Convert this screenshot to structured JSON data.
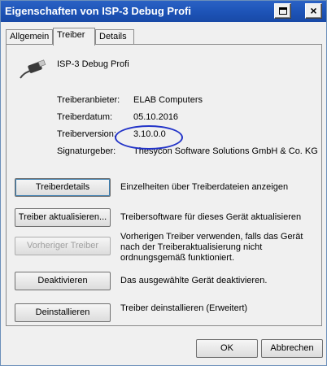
{
  "window": {
    "title": "Eigenschaften von ISP-3 Debug Profi",
    "help_glyph": "help-icon",
    "close_glyph": "×"
  },
  "tabs": [
    {
      "label": "Allgemein"
    },
    {
      "label": "Treiber"
    },
    {
      "label": "Details"
    }
  ],
  "device": {
    "name": "ISP-3 Debug Profi",
    "icon": "usb-device-icon"
  },
  "info": {
    "provider_label": "Treiberanbieter:",
    "provider_value": "ELAB Computers",
    "date_label": "Treiberdatum:",
    "date_value": "05.10.2016",
    "version_label": "Treiberversion:",
    "version_value": "3.10.0.0",
    "signer_label": "Signaturgeber:",
    "signer_value": "Thesycon Software Solutions GmbH & Co. KG"
  },
  "actions": [
    {
      "button": "Treiberdetails",
      "description": "Einzelheiten über Treiberdateien anzeigen"
    },
    {
      "button": "Treiber aktualisieren...",
      "description": "Treibersoftware für dieses Gerät aktualisieren"
    },
    {
      "button": "Vorheriger Treiber",
      "description": "Vorherigen Treiber verwenden, falls das Gerät nach der Treiberaktualisierung nicht ordnungsgemäß funktioniert."
    },
    {
      "button": "Deaktivieren",
      "description": "Das ausgewählte Gerät deaktivieren."
    },
    {
      "button": "Deinstallieren",
      "description": "Treiber deinstallieren (Erweitert)"
    }
  ],
  "footer": {
    "ok_label": "OK",
    "cancel_label": "Abbrechen"
  },
  "colors": {
    "titlebar": "#1e54b8",
    "highlight": "#2233c8"
  }
}
